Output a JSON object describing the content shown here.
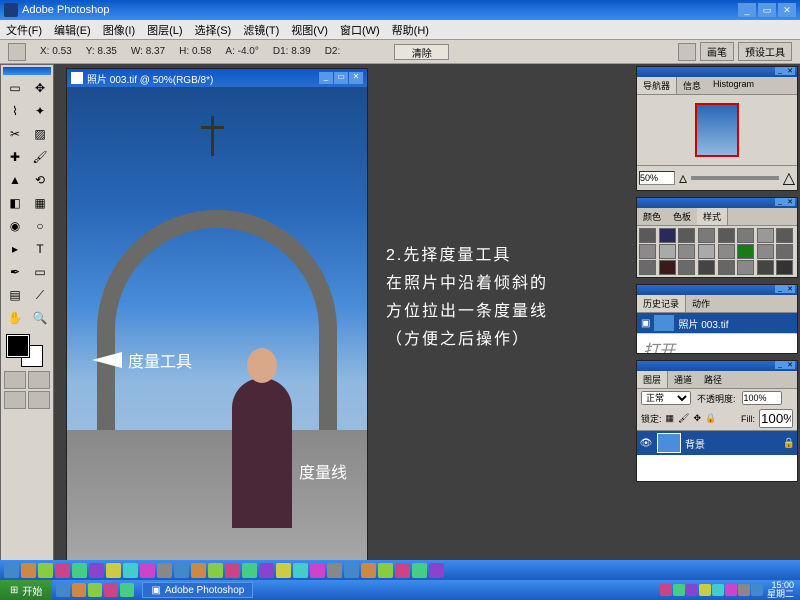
{
  "titlebar": {
    "app_name": "Adobe Photoshop"
  },
  "menu": {
    "file": "文件(F)",
    "edit": "编辑(E)",
    "image": "图像(I)",
    "layer": "图层(L)",
    "select": "选择(S)",
    "filter": "滤镜(T)",
    "view": "视图(V)",
    "window": "窗口(W)",
    "help": "帮助(H)"
  },
  "optbar": {
    "x_label": "X:",
    "x_val": "0.53",
    "y_label": "Y:",
    "y_val": "8.35",
    "w_label": "W:",
    "w_val": "8.37",
    "h_label": "H:",
    "h_val": "0.58",
    "a_label": "A:",
    "a_val": "-4.0°",
    "d1_label": "D1:",
    "d1_val": "8.39",
    "d2_label": "D2:",
    "d2_val": "",
    "clear": "清除",
    "tab_brush": "画笔",
    "tab_preset": "预设工具"
  },
  "doc": {
    "title": "照片 003.tif @ 50%(RGB/8*)"
  },
  "annotations": {
    "tool_label": "度量工具",
    "line_label": "度量线",
    "instructions": "2.先择度量工具\n在照片中沿着倾斜的\n方位拉出一条度量线\n（方便之后操作）"
  },
  "panels": {
    "navigator": {
      "tab1": "导航器",
      "tab2": "信息",
      "tab3": "Histogram",
      "zoom": "50%"
    },
    "color": {
      "tab1": "颜色",
      "tab2": "色板",
      "tab3": "样式"
    },
    "history": {
      "tab1": "历史记录",
      "tab2": "动作",
      "item1": "照片 003.tif",
      "item2": "打开"
    },
    "layers": {
      "tab1": "图层",
      "tab2": "通道",
      "tab3": "路径",
      "blend": "正常",
      "opacity_label": "不透明度:",
      "opacity": "100%",
      "lock_label": "锁定:",
      "fill_label": "Fill:",
      "fill": "100%",
      "bg_layer": "背景"
    }
  },
  "swatches": [
    "#5a5a5a",
    "#2a2a5a",
    "#5a5a5a",
    "#7a7a7a",
    "#5a5a5a",
    "#7a7a7a",
    "#999999",
    "#5a5a5a",
    "#8a8a8a",
    "#aaaaaa",
    "#8a8a8a",
    "#aaaaaa",
    "#8a8a8a",
    "#1a7a1a",
    "#8a8a8a",
    "#6a6a6a",
    "#6a6a6a",
    "#3a1a1a",
    "#6a6a6a",
    "#444444",
    "#666666",
    "#888888",
    "#444444",
    "#333333"
  ],
  "taskbar": {
    "start": "开始",
    "app_task": "Adobe Photoshop",
    "time": "15:00",
    "date": "星期二"
  }
}
